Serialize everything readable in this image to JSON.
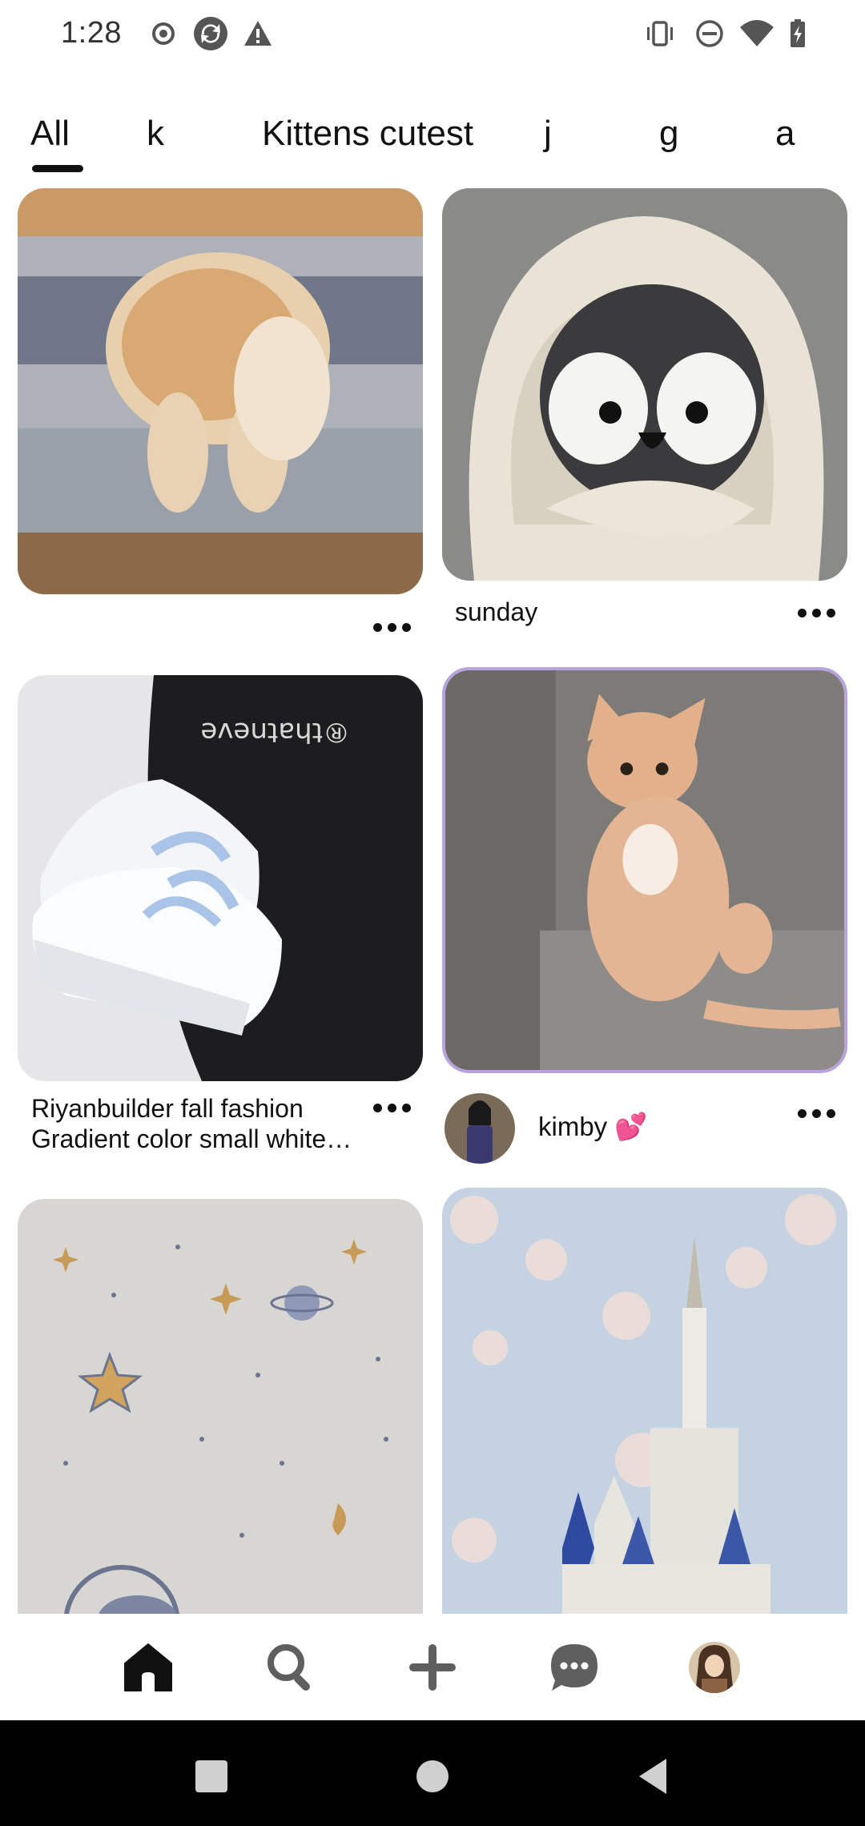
{
  "status_bar": {
    "time": "1:28",
    "left_icons": [
      "record-icon",
      "sync-icon",
      "warning-icon"
    ],
    "right_icons": [
      "vibrate-icon",
      "do-not-disturb-icon",
      "wifi-icon",
      "battery-charging-icon"
    ]
  },
  "tabs": [
    {
      "label": "All",
      "selected": true
    },
    {
      "label": "k",
      "selected": false
    },
    {
      "label": "Kittens cutest",
      "selected": false
    },
    {
      "label": "j",
      "selected": false
    },
    {
      "label": "g",
      "selected": false
    },
    {
      "label": "a",
      "selected": false
    }
  ],
  "pins": [
    {
      "id": "kitten-litter",
      "caption": "",
      "icon": "kitten-image"
    },
    {
      "id": "penguin-blanket",
      "caption": "sunday",
      "icon": "penguin-image"
    },
    {
      "id": "sneakers",
      "caption_line1": "Riyanbuilder fall fashion",
      "caption_line2": "Gradient color small white…",
      "icon": "sneakers-image"
    },
    {
      "id": "ginger-kitten",
      "creator": "kimby 💕",
      "icon": "kitten-image"
    },
    {
      "id": "stars-wallpaper",
      "icon": "stars-image"
    },
    {
      "id": "castle-blossoms",
      "icon": "castle-image"
    }
  ],
  "bottom_nav": {
    "items": [
      "home-icon",
      "search-icon",
      "create-icon",
      "messages-icon",
      "profile-avatar"
    ],
    "active": "home-icon"
  },
  "system_nav": [
    "recents-button",
    "home-button",
    "back-button"
  ],
  "colors": {
    "accent": "#111111",
    "highlight_border": "#b9a3dd"
  }
}
